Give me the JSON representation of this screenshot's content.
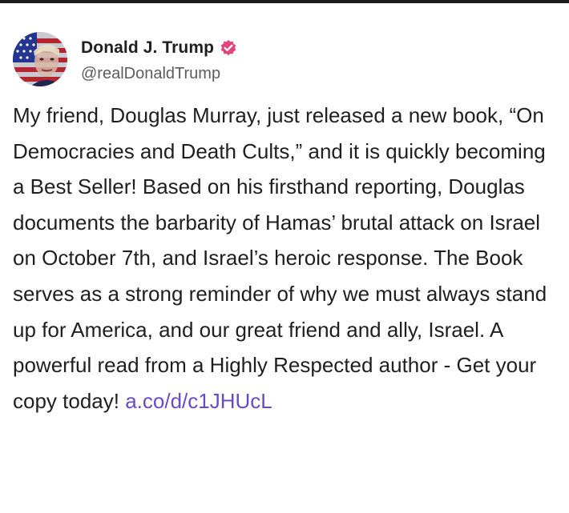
{
  "account": {
    "display_name": "Donald J. Trump",
    "handle": "@realDonaldTrump",
    "verified_badge_icon": "verified-check-icon",
    "verified_badge_color": "#e0457b",
    "avatar_icon": "flag-portrait-avatar"
  },
  "post": {
    "text": "My friend, Douglas Murray, just released a new book, “On Democracies and Death Cults,” and it is quickly becoming a Best Seller! Based on his firsthand reporting, Douglas documents the barbarity of Hamas’ brutal attack on Israel on October 7th, and Israel’s heroic response. The Book serves as a strong reminder of why we must always stand up for America, and our great friend and ally, Israel. A powerful read from a Highly Respected author - Get your copy today!",
    "link_text": "a.co/d/c1JHUcL",
    "link_color": "#6a49c9"
  }
}
